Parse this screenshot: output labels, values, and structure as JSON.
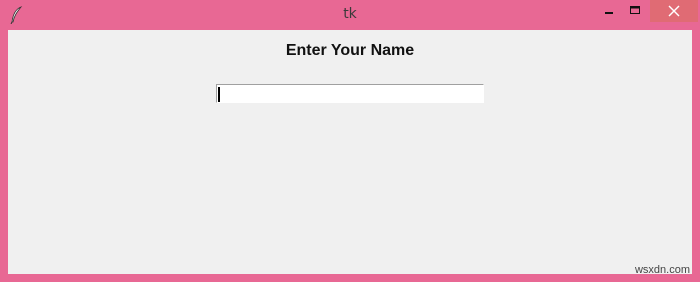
{
  "window": {
    "title": "tk",
    "accent_color": "#e86894",
    "close_hover_color": "#e06b74",
    "icon": "feather-icon"
  },
  "controls": {
    "minimize_icon": "minimize-icon",
    "maximize_icon": "maximize-icon",
    "close_icon": "close-icon"
  },
  "main": {
    "heading": "Enter Your Name",
    "name_input": {
      "value": "",
      "placeholder": ""
    }
  },
  "watermark": "wsxdn.com"
}
